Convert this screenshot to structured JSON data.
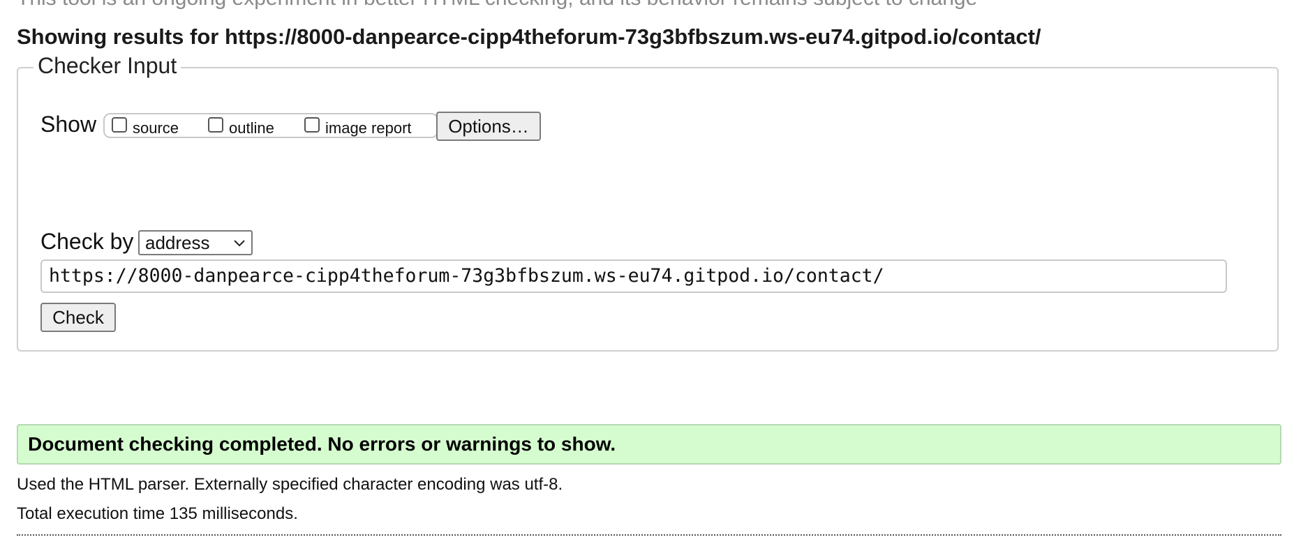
{
  "notice": {
    "cut_text": "This tool is an ongoing experiment in better HTML checking, and its behavior remains subject to change"
  },
  "results_heading": "Showing results for https://8000-danpearce-cipp4theforum-73g3bfbszum.ws-eu74.gitpod.io/contact/",
  "checker_input": {
    "legend": "Checker Input",
    "show_label": "Show",
    "show_options": [
      {
        "label": "source",
        "checked": false
      },
      {
        "label": "outline",
        "checked": false
      },
      {
        "label": "image report",
        "checked": false
      }
    ],
    "options_button": "Options…",
    "check_by_label": "Check by",
    "check_by_selected": "address",
    "url_value": "https://8000-danpearce-cipp4theforum-73g3bfbszum.ws-eu74.gitpod.io/contact/",
    "check_button": "Check"
  },
  "result": {
    "success_message": "Document checking completed. No errors or warnings to show.",
    "success_bg": "#d5fccf",
    "parser_info": "Used the HTML parser. Externally specified character encoding was utf-8.",
    "execution_time": "Total execution time 135 milliseconds."
  }
}
